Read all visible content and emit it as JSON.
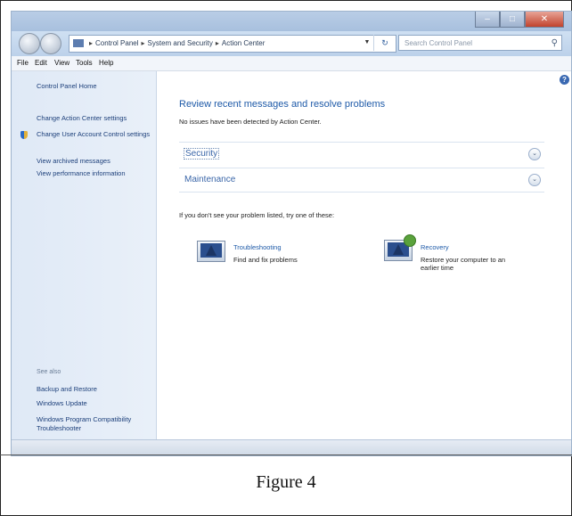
{
  "address_bar": {
    "crumbs": [
      "Control Panel",
      "System and Security",
      "Action Center"
    ],
    "search_placeholder": "Search Control Panel"
  },
  "menu": [
    "File",
    "Edit",
    "View",
    "Tools",
    "Help"
  ],
  "sidebar": {
    "home": "Control Panel Home",
    "links": [
      "Change Action Center settings",
      "Change User Account Control settings",
      "View archived messages",
      "View performance information"
    ],
    "see_also_heading": "See also",
    "see_also": [
      "Backup and Restore",
      "Windows Update",
      "Windows Program Compatibility Troubleshooter"
    ]
  },
  "main": {
    "title": "Review recent messages and resolve problems",
    "status": "No issues have been detected by Action Center.",
    "sections": [
      "Security",
      "Maintenance"
    ],
    "hint": "If you don't see your problem listed, try one of these:",
    "tools": [
      {
        "label": "Troubleshooting",
        "desc": "Find and fix problems"
      },
      {
        "label": "Recovery",
        "desc": "Restore your computer to an earlier time"
      }
    ]
  },
  "caption": "Figure 4",
  "colors": {
    "link": "#1e5aa8",
    "nav_bg": "#dfe9f6",
    "accent": "#3a66a8"
  },
  "icons": [
    "back-arrow-icon",
    "forward-arrow-icon",
    "folder-icon",
    "refresh-icon",
    "search-icon",
    "help-icon",
    "uac-shield-icon",
    "troubleshooting-icon",
    "recovery-icon",
    "expand-chevron-icon"
  ]
}
